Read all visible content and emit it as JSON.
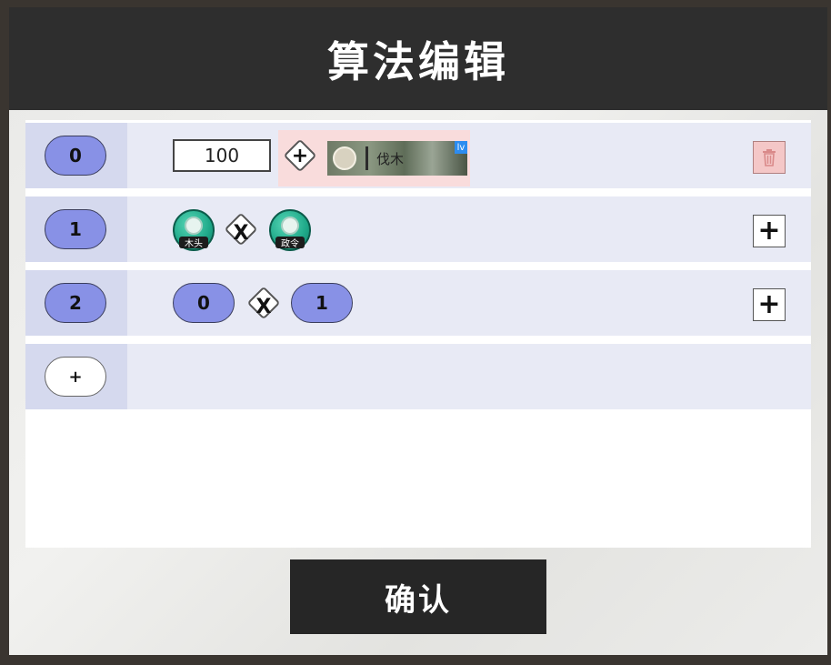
{
  "dialog": {
    "title": "算法编辑",
    "confirm_label": "确认"
  },
  "rows": [
    {
      "index": "0",
      "value": "100",
      "operator": "+",
      "source": {
        "name": "伐木",
        "level_badge": "lv",
        "icon": "wood-log-thumbnail"
      },
      "action": "delete-icon"
    },
    {
      "index": "1",
      "left_resource": {
        "name": "木头",
        "icon": "wood-log-icon"
      },
      "operator": "X",
      "right_resource": {
        "name": "政令",
        "icon": "wood-log-icon"
      },
      "action": "plus-icon"
    },
    {
      "index": "2",
      "left_ref": "0",
      "operator": "X",
      "right_ref": "1",
      "action": "plus-icon"
    }
  ],
  "add_row_label": "+",
  "row_add_label": "+",
  "colors": {
    "header_bg": "#2e2e2e",
    "row_bg": "#e8eaf5",
    "index_pill": "#8891e6",
    "resource_icon": "#1ea888",
    "highlight": "#f9dcdc",
    "delete_bg": "#f4c7c7",
    "confirm_bg": "#262626"
  }
}
